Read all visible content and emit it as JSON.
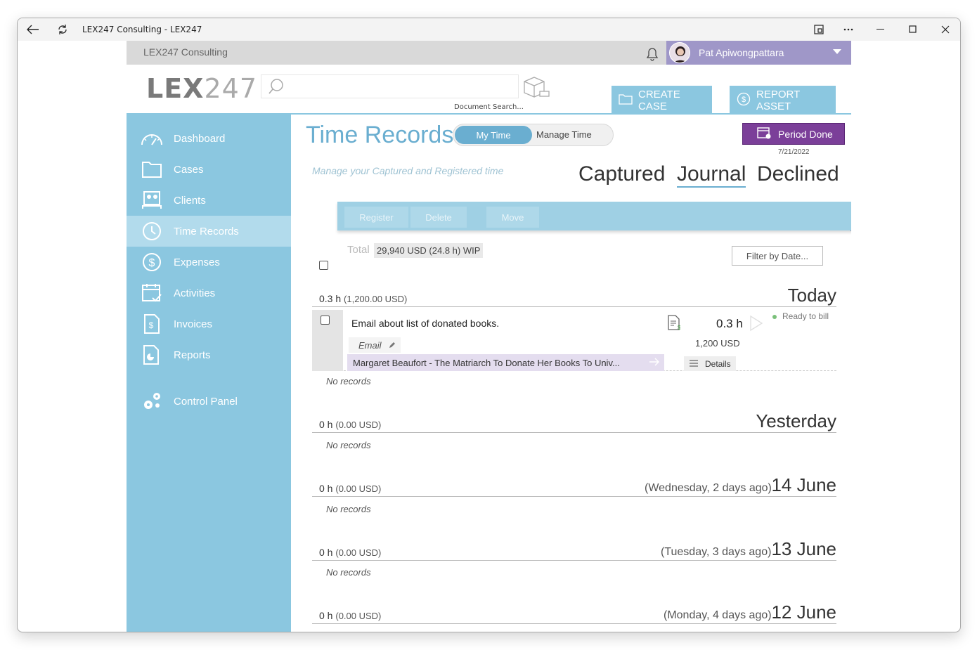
{
  "window": {
    "title": "LEX247 Consulting - LEX247"
  },
  "topbar": {
    "org": "LEX247 Consulting",
    "user_name": "Pat Apiwongpattara"
  },
  "header": {
    "logo_bold": "LEX",
    "logo_light": "247",
    "search_caption": "Document Search...",
    "create_case_label": "CREATE CASE",
    "report_asset_label": "REPORT ASSET"
  },
  "sidebar": {
    "items": [
      {
        "label": "Dashboard",
        "icon": "gauge-icon"
      },
      {
        "label": "Cases",
        "icon": "folder-icon"
      },
      {
        "label": "Clients",
        "icon": "clients-icon"
      },
      {
        "label": "Time Records",
        "icon": "clock-icon",
        "active": true
      },
      {
        "label": "Expenses",
        "icon": "dollar-icon"
      },
      {
        "label": "Activities",
        "icon": "calendar-check-icon"
      },
      {
        "label": "Invoices",
        "icon": "invoice-icon"
      },
      {
        "label": "Reports",
        "icon": "report-icon"
      },
      {
        "label": "Control Panel",
        "icon": "gears-icon"
      }
    ]
  },
  "main": {
    "title": "Time Records",
    "toggle": {
      "selected": "My Time",
      "other": "Manage Time"
    },
    "period_done": {
      "label": "Period Done",
      "date": "7/21/2022"
    },
    "subtitle": "Manage your Captured and Registered time",
    "tabs": [
      {
        "label": "Captured"
      },
      {
        "label": "Journal",
        "selected": true
      },
      {
        "label": "Declined"
      }
    ],
    "toolbar": {
      "register": "Register",
      "delete": "Delete",
      "move": "Move"
    },
    "total_label": "Total",
    "total_value": "29,940 USD (24.8 h)  WIP",
    "filter_placeholder": "Filter by Date..."
  },
  "groups": [
    {
      "hours": "0.3 h",
      "usd": "(1,200.00 USD)",
      "date": "Today",
      "ago": "",
      "no_records": "No records"
    },
    {
      "hours": "0 h",
      "usd": "(0.00 USD)",
      "date": "Yesterday",
      "ago": "",
      "no_records": "No records"
    },
    {
      "hours": "0 h",
      "usd": "(0.00 USD)",
      "date": "14 June",
      "ago": "(Wednesday, 2 days ago)",
      "no_records": "No records"
    },
    {
      "hours": "0 h",
      "usd": "(0.00 USD)",
      "date": "13 June",
      "ago": "(Tuesday, 3 days ago)",
      "no_records": "No records"
    },
    {
      "hours": "0 h",
      "usd": "(0.00 USD)",
      "date": "12 June",
      "ago": "(Monday, 4 days ago)",
      "no_records": ""
    }
  ],
  "record": {
    "description": "Email about list of donated books.",
    "type": "Email",
    "case": "Margaret Beaufort - The Matriarch To Donate Her Books To Univ...",
    "hours": "0.3 h",
    "amount": "1,200 USD",
    "status": "Ready to bill",
    "details_label": "Details"
  },
  "colors": {
    "accent": "#8bc7e0",
    "title": "#6aaed0",
    "period": "#7b3f99",
    "user_bar": "#9f97c8"
  }
}
